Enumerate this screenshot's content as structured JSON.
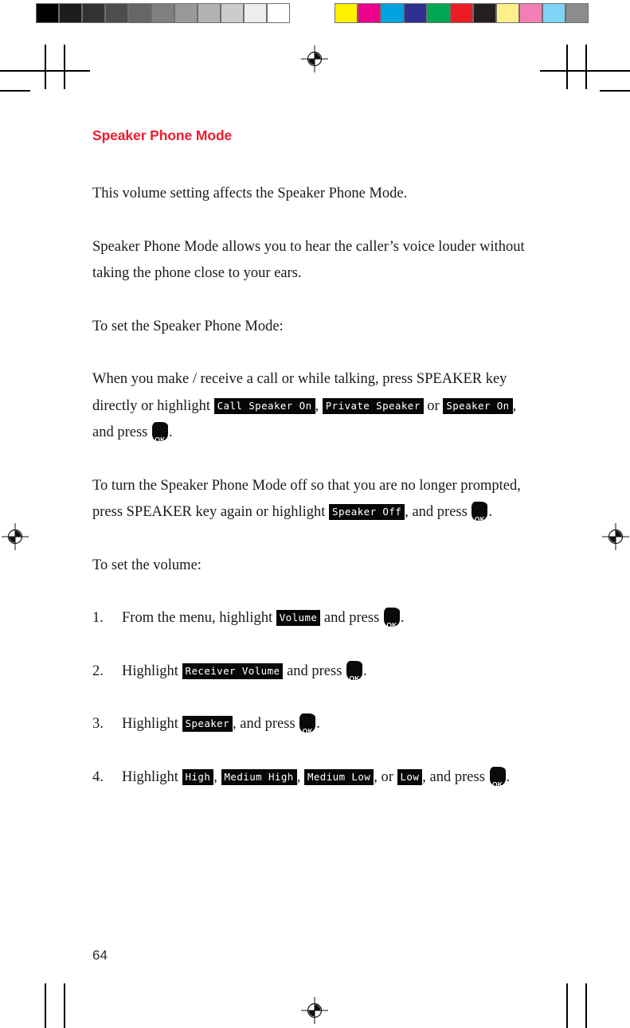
{
  "document": {
    "page_number": "64",
    "heading": "Speaker Phone Mode",
    "heading_color": "#ed1c30",
    "body_color": "#1a1a1a"
  },
  "calibration": {
    "gray_wedge_name": "grayscale-step-wedge",
    "gray_wedge": [
      "#000000",
      "#1c1c1c",
      "#333333",
      "#4d4d4d",
      "#666666",
      "#808080",
      "#999999",
      "#b3b3b3",
      "#cccccc",
      "#ededed",
      "#ffffff"
    ],
    "color_bar_name": "process-color-bar",
    "color_bar": [
      "#fff200",
      "#ec008c",
      "#00a3e0",
      "#2e3192",
      "#00a651",
      "#ed1c24",
      "#231f20",
      "#fdf08a",
      "#f47fb6",
      "#7fd4f5",
      "#8c8c8c"
    ]
  },
  "paragraphs": {
    "p1": "This volume setting affects the Speaker Phone Mode.",
    "p2": "Speaker Phone Mode allows you to hear the caller’s voice louder without taking the phone close to your ears.",
    "p3": "To set the Speaker Phone Mode:",
    "p4_a": "When you make / receive a call or while talking, press SPEAKER key directly or highlight ",
    "p4_lcd1": "Call Speaker On",
    "p4_b": ", ",
    "p4_lcd2": "Private Speaker",
    "p4_c": " or ",
    "p4_lcd3": "Speaker On",
    "p4_d": ", and press ",
    "p4_e": ".",
    "p5_a": "To turn the Speaker Phone Mode off so that you are no longer prompted, press SPEAKER key again or highlight ",
    "p5_lcd1": "Speaker Off",
    "p5_b": ", and press ",
    "p5_c": ".",
    "p6": "To set the volume:"
  },
  "steps": [
    {
      "num": "1.",
      "a": "From the menu, highlight ",
      "lcd": [
        "Volume"
      ],
      "b": " and press ",
      "c": "."
    },
    {
      "num": "2.",
      "a": "Highlight ",
      "lcd": [
        "Receiver Volume"
      ],
      "b": " and press ",
      "c": "."
    },
    {
      "num": "3.",
      "a": "Highlight ",
      "lcd": [
        "Speaker"
      ],
      "b": ", and press ",
      "c": "."
    },
    {
      "num": "4.",
      "a": "Highlight ",
      "lcd": [
        "High",
        "Medium High",
        "Medium Low",
        "Low"
      ],
      "sep": ", ",
      "or": ", or ",
      "b": ", and press ",
      "c": "."
    }
  ],
  "key_glyph": {
    "label": "OK"
  }
}
